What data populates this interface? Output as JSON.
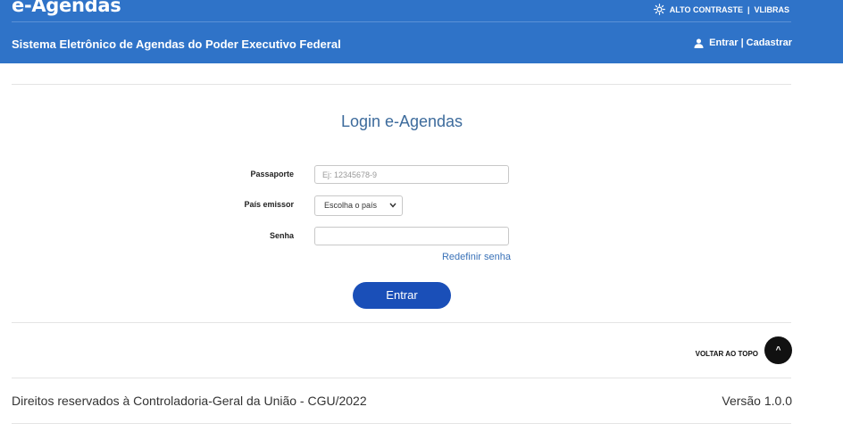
{
  "header": {
    "logo": "e-Agendas",
    "high_contrast": "ALTO CONTRASTE",
    "separator": "|",
    "vlibras": "VLIBRAS",
    "subtitle": "Sistema Eletrônico de Agendas do Poder Executivo Federal",
    "login_link": "Entrar",
    "register_link": "Cadastrar"
  },
  "login": {
    "title": "Login e-Agendas",
    "passport_label": "Passaporte",
    "passport_placeholder": "Ej: 12345678-9",
    "country_label": "País emissor",
    "country_selected": "Escolha o país",
    "password_label": "Senha",
    "reset_link": "Redefinir senha",
    "submit_label": "Entrar"
  },
  "footer": {
    "back_to_top": "VOLTAR AO TOPO",
    "top_icon": "^",
    "copyright": "Direitos reservados à Controladoria-Geral da União - CGU/2022",
    "version": "Versão 1.0.0"
  },
  "icons": {
    "contrast": "sun-icon",
    "user": "user-icon"
  },
  "colors": {
    "header_bg": "#2f73c8",
    "button_bg": "#1a4fb8",
    "title_color": "#3d6b9c",
    "link_color": "#3a72b8"
  }
}
